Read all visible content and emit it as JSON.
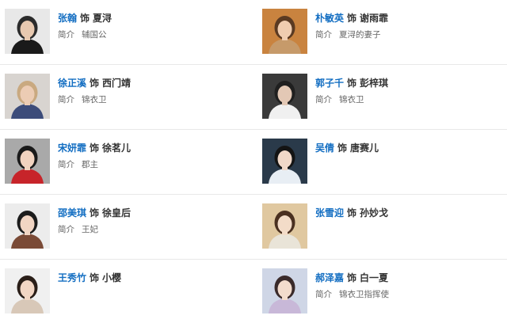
{
  "cast": [
    {
      "actor": "张翰",
      "sep": "饰",
      "role": "夏浔",
      "intro_label": "简介",
      "intro": "辅国公",
      "photo_bg": "#e8e8e8",
      "hair": "#2b2b2b",
      "skin": "#e8c9b0",
      "cloth": "#1a1a1a"
    },
    {
      "actor": "朴敏英",
      "sep": "饰",
      "role": "谢雨霏",
      "intro_label": "简介",
      "intro": "夏浔的妻子",
      "photo_bg": "#c9833f",
      "hair": "#5a3a22",
      "skin": "#f0cdb0",
      "cloth": "#c69a6a"
    },
    {
      "actor": "徐正溪",
      "sep": "饰",
      "role": "西门靖",
      "intro_label": "简介",
      "intro": "锦衣卫",
      "photo_bg": "#d8d4d0",
      "hair": "#c9a980",
      "skin": "#ecccb4",
      "cloth": "#3c4c7a"
    },
    {
      "actor": "郭子千",
      "sep": "饰",
      "role": "彭梓琪",
      "intro_label": "简介",
      "intro": "锦衣卫",
      "photo_bg": "#3a3a3a",
      "hair": "#1f1f1f",
      "skin": "#e3c8b5",
      "cloth": "#f0f0f0"
    },
    {
      "actor": "宋妍霏",
      "sep": "饰",
      "role": "徐茗儿",
      "intro_label": "简介",
      "intro": "郡主",
      "photo_bg": "#a9a9a9",
      "hair": "#1a1a1a",
      "skin": "#f1d3c0",
      "cloth": "#c7242a"
    },
    {
      "actor": "吴倩",
      "sep": "饰",
      "role": "唐赛儿",
      "intro_label": "",
      "intro": "",
      "photo_bg": "#2a3a4a",
      "hair": "#141414",
      "skin": "#f0d8c8",
      "cloth": "#e8eef4"
    },
    {
      "actor": "邵美琪",
      "sep": "饰",
      "role": "徐皇后",
      "intro_label": "简介",
      "intro": "王妃",
      "photo_bg": "#ececec",
      "hair": "#1c1c1c",
      "skin": "#f1d5c3",
      "cloth": "#7a4a36"
    },
    {
      "actor": "张雪迎",
      "sep": "饰",
      "role": "孙妙戈",
      "intro_label": "",
      "intro": "",
      "photo_bg": "#e0c8a0",
      "hair": "#4a3020",
      "skin": "#f3dcc8",
      "cloth": "#e9e4d8"
    },
    {
      "actor": "王秀竹",
      "sep": "饰",
      "role": "小樱",
      "intro_label": "",
      "intro": "",
      "photo_bg": "#f0f0f0",
      "hair": "#2a1e18",
      "skin": "#f2d6c4",
      "cloth": "#d8c8b8"
    },
    {
      "actor": "郝泽嘉",
      "sep": "饰",
      "role": "白一夏",
      "intro_label": "简介",
      "intro": "锦衣卫指挥使",
      "photo_bg": "#cfd6e6",
      "hair": "#3a2a2a",
      "skin": "#f3dccd",
      "cloth": "#c8b8d8"
    }
  ]
}
